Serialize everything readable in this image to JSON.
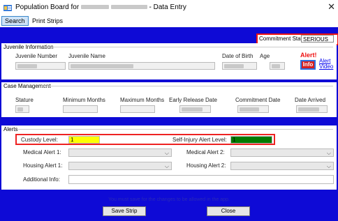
{
  "window": {
    "title_prefix": "Population Board for",
    "title_suffix": "- Data Entry",
    "close_glyph": "✕"
  },
  "menu": {
    "search": "Search",
    "print_strips": "Print Strips"
  },
  "commitment": {
    "label": "Commitment Status",
    "value": "SERIOUS"
  },
  "juvenile": {
    "section": "Juvenile Information",
    "number_label": "Juvenile Number",
    "name_label": "Juvenile Name",
    "dob_label": "Date of Birth",
    "age_label": "Age",
    "alert_label": "Alert!",
    "info_button": "Info",
    "alert_video_link": "Alert Video"
  },
  "case": {
    "section": "Case Management",
    "stature_label": "Stature",
    "min_months_label": "Minimum Months",
    "max_months_label": "Maximum Months",
    "early_release_label": "Early Release Date",
    "commitment_date_label": "Commitment Date",
    "date_arrived_label": "Date Arrived"
  },
  "alerts": {
    "section": "Alerts",
    "custody_label": "Custody Level:",
    "custody_value": "1",
    "self_injury_label": "Self-Injury Alert Level:",
    "self_injury_value": "1",
    "medical1_label": "Medical Alert 1:",
    "medical2_label": "Medical Alert 2:",
    "housing1_label": "Housing Alert 1:",
    "housing2_label": "Housing Alert 2:",
    "additional_label": "Additional Info:",
    "custody_color": "#ffff00",
    "self_injury_color": "#007a00"
  },
  "footer": {
    "message": "You must save for the changes to be allowed in the app.",
    "save": "Save Strip",
    "close": "Close"
  }
}
